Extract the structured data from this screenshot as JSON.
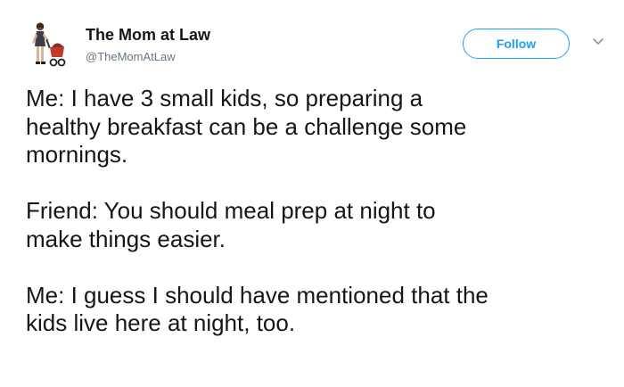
{
  "user": {
    "display_name": "The Mom at Law",
    "handle": "@TheMomAtLaw",
    "avatar_icon": "mother-with-stroller-icon"
  },
  "actions": {
    "follow_label": "Follow",
    "menu_icon": "chevron-down-icon"
  },
  "colors": {
    "accent": "#1da1f2",
    "text": "#14171a",
    "muted": "#657786"
  },
  "tweet": {
    "paragraphs": [
      {
        "lines": [
          "Me: I have 3 small kids, so preparing a",
          "healthy breakfast can be a challenge some",
          "mornings."
        ]
      },
      {
        "lines": [
          "Friend: You should meal prep at night to",
          "make things easier."
        ]
      },
      {
        "lines": [
          "Me: I guess I should have mentioned that the",
          "kids live here at night, too."
        ]
      }
    ]
  }
}
